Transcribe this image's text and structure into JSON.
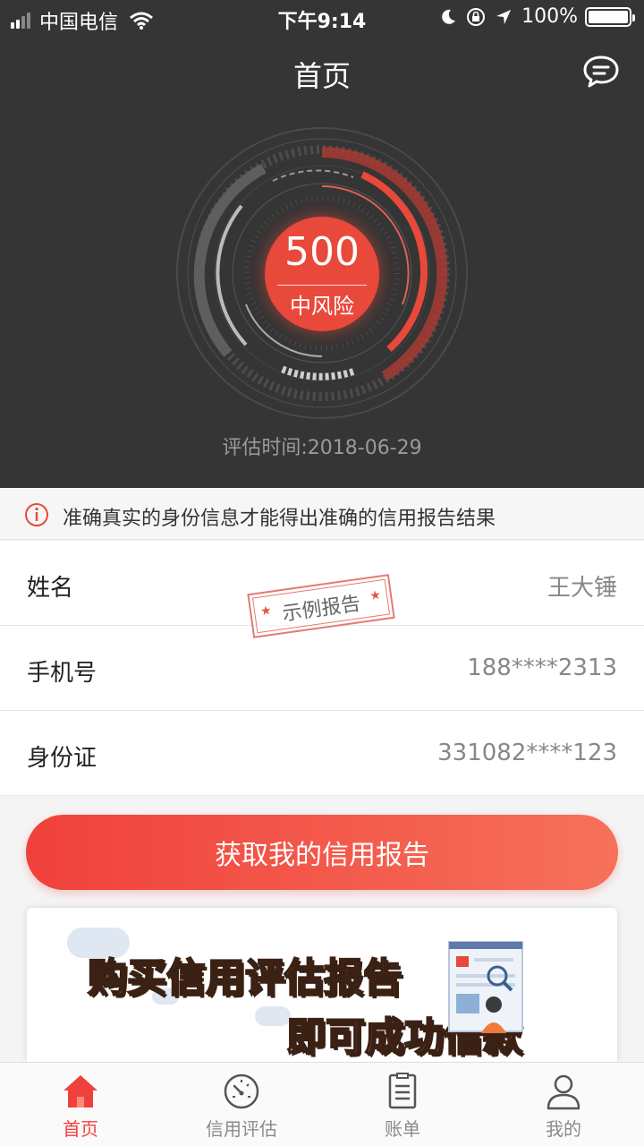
{
  "status_bar": {
    "carrier": "中国电信",
    "time": "下午9:14",
    "battery": "100%"
  },
  "header": {
    "title": "首页"
  },
  "credit": {
    "score": "500",
    "risk_level": "中风险",
    "eval_label": "评估时间:",
    "eval_date": "2018-06-29"
  },
  "notice": {
    "text": "准确真实的身份信息才能得出准确的信用报告结果"
  },
  "info": {
    "rows": [
      {
        "label": "姓名",
        "value": "王大锤"
      },
      {
        "label": "手机号",
        "value": "188****2313"
      },
      {
        "label": "身份证",
        "value": "331082****123"
      }
    ],
    "stamp": "示例报告"
  },
  "cta": {
    "label": "获取我的信用报告"
  },
  "banner": {
    "line1_prefix": "购买",
    "line1_highlight": "信用评估报告",
    "line2": "即可成功借款"
  },
  "tabs": [
    {
      "label": "首页",
      "icon": "home-icon",
      "active": true
    },
    {
      "label": "信用评估",
      "icon": "gauge-icon",
      "active": false
    },
    {
      "label": "账单",
      "icon": "bill-icon",
      "active": false
    },
    {
      "label": "我的",
      "icon": "user-icon",
      "active": false
    }
  ],
  "colors": {
    "accent": "#f0403c",
    "header_bg": "#353535",
    "score_bg": "#e8493a"
  }
}
